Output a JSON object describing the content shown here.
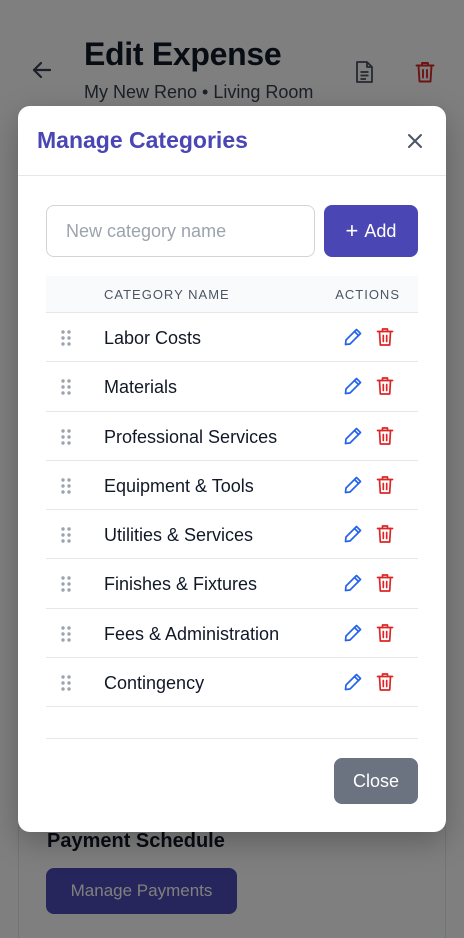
{
  "page": {
    "title": "Edit Expense",
    "subtitle": "My New Reno • Living Room",
    "section_title": "Payment Schedule",
    "manage_payments_label": "Manage Payments"
  },
  "modal": {
    "title": "Manage Categories",
    "input_placeholder": "New category name",
    "input_value": "",
    "add_label": "Add",
    "columns": {
      "name": "CATEGORY NAME",
      "actions": "ACTIONS"
    },
    "categories": [
      {
        "label": "Labor Costs"
      },
      {
        "label": "Materials"
      },
      {
        "label": "Professional Services"
      },
      {
        "label": "Equipment & Tools"
      },
      {
        "label": "Utilities & Services"
      },
      {
        "label": "Finishes & Fixtures"
      },
      {
        "label": "Fees & Administration"
      },
      {
        "label": "Contingency"
      }
    ],
    "close_label": "Close"
  },
  "icons": {
    "back": "arrow-left-icon",
    "document": "document-icon",
    "delete": "trash-icon",
    "close": "close-icon",
    "drag": "drag-handle-icon",
    "edit": "pencil-icon"
  },
  "colors": {
    "accent": "#4a46b3",
    "danger": "#dc2626",
    "edit": "#2563eb",
    "neutral_button": "#6b7280"
  }
}
